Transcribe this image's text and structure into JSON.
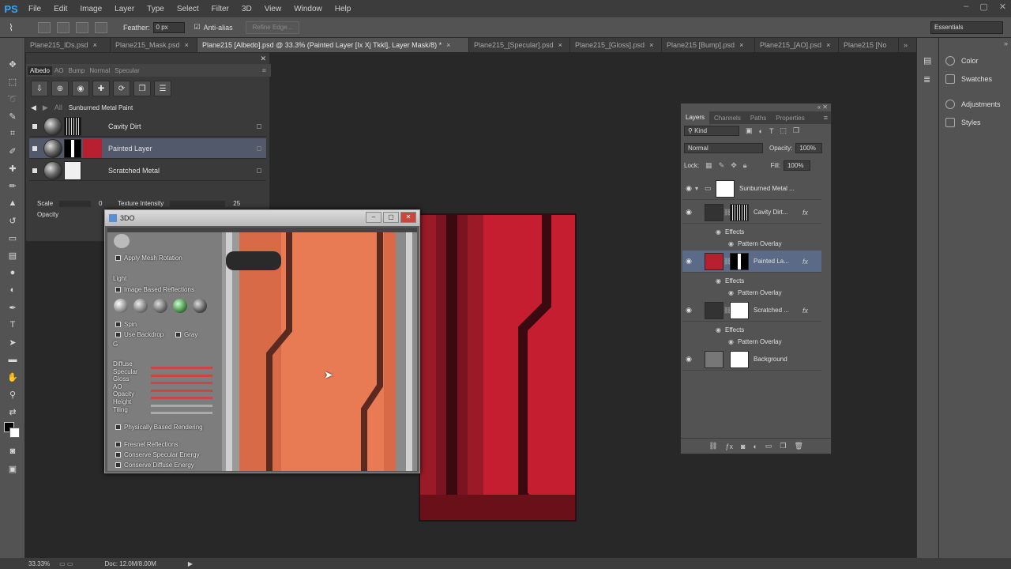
{
  "menu": {
    "logo": "PS",
    "items": [
      "File",
      "Edit",
      "Image",
      "Layer",
      "Type",
      "Select",
      "Filter",
      "3D",
      "View",
      "Window",
      "Help"
    ],
    "window_controls": [
      "–",
      "▢",
      "✕"
    ]
  },
  "options": {
    "feather_label": "Feather:",
    "feather_value": "0 px",
    "antialias_label": "Anti-alias",
    "refine_edge": "Refine Edge...",
    "workspace": "Essentials"
  },
  "tabs": [
    {
      "label": "Plane215_IDs.psd",
      "active": false
    },
    {
      "label": "Plane215_Mask.psd",
      "active": false
    },
    {
      "label": "Plane215 [Albedo].psd @ 33.3% (Painted Layer [Ix Xj Tkkl], Layer Mask/8) *",
      "active": true
    },
    {
      "label": "Plane215_[Specular].psd",
      "active": false
    },
    {
      "label": "Plane215_[Gloss].psd",
      "active": false
    },
    {
      "label": "Plane215 [Bump].psd",
      "active": false
    },
    {
      "label": "Plane215_[AO].psd",
      "active": false
    },
    {
      "label": "Plane215 [No",
      "active": false
    }
  ],
  "tab_close": "×",
  "tab_overflow": "»",
  "plugin": {
    "subtabs": [
      "Albedo",
      "AO",
      "Bump",
      "Normal",
      "Specular"
    ],
    "path_all": "All",
    "path_name": "Sunburned Metal Paint",
    "layers": [
      {
        "name": "Cavity Dirt"
      },
      {
        "name": "Painted Layer"
      },
      {
        "name": "Scratched Metal"
      }
    ],
    "scale_label": "Scale",
    "scale_value": "0",
    "texture_intensity_label": "Texture Intensity",
    "texture_intensity_value": "25",
    "opacity_label": "Opacity"
  },
  "win3do": {
    "title": "3DO",
    "apply_mesh_rotation": "Apply Mesh Rotation",
    "light": "Light",
    "ibl": "Image Based Reflections",
    "spin": "Spin",
    "use_backdrop": "Use Backdrop",
    "gray": "Gray",
    "g_label": "G",
    "channels": [
      "Diffuse",
      "Specular",
      "Gloss",
      "AO",
      "Opacity",
      "Height",
      "Tiling"
    ],
    "pbr": "Physically Based Rendering",
    "fresnel": "Fresnel Reflections",
    "conserve_spec": "Conserve Specular Energy",
    "conserve_diff": "Conserve Diffuse Energy"
  },
  "layers_panel": {
    "tabs": [
      "Layers",
      "Channels",
      "Paths",
      "Properties"
    ],
    "kind": "Kind",
    "blend_mode": "Normal",
    "opacity_label": "Opacity:",
    "opacity_value": "100%",
    "lock_label": "Lock:",
    "fill_label": "Fill:",
    "fill_value": "100%",
    "group_name": "Sunburned Metal ...",
    "layers": [
      {
        "name": "Cavity Dirt...",
        "effects": "Effects",
        "effect": "Pattern Overlay"
      },
      {
        "name": "Painted La...",
        "effects": "Effects",
        "effect": "Pattern Overlay"
      },
      {
        "name": "Scratched ...",
        "effects": "Effects",
        "effect": "Pattern Overlay"
      },
      {
        "name": "Background"
      }
    ],
    "fx_label": "fx"
  },
  "right_panels": [
    "Color",
    "Swatches",
    "Adjustments",
    "Styles"
  ],
  "status": {
    "zoom": "33.33%",
    "doc": "Doc: 12.0M/8.00M"
  },
  "colors": {
    "accent_red": "#b8202f",
    "selection_blue": "#5a6a87",
    "panel_gray": "#535353"
  }
}
